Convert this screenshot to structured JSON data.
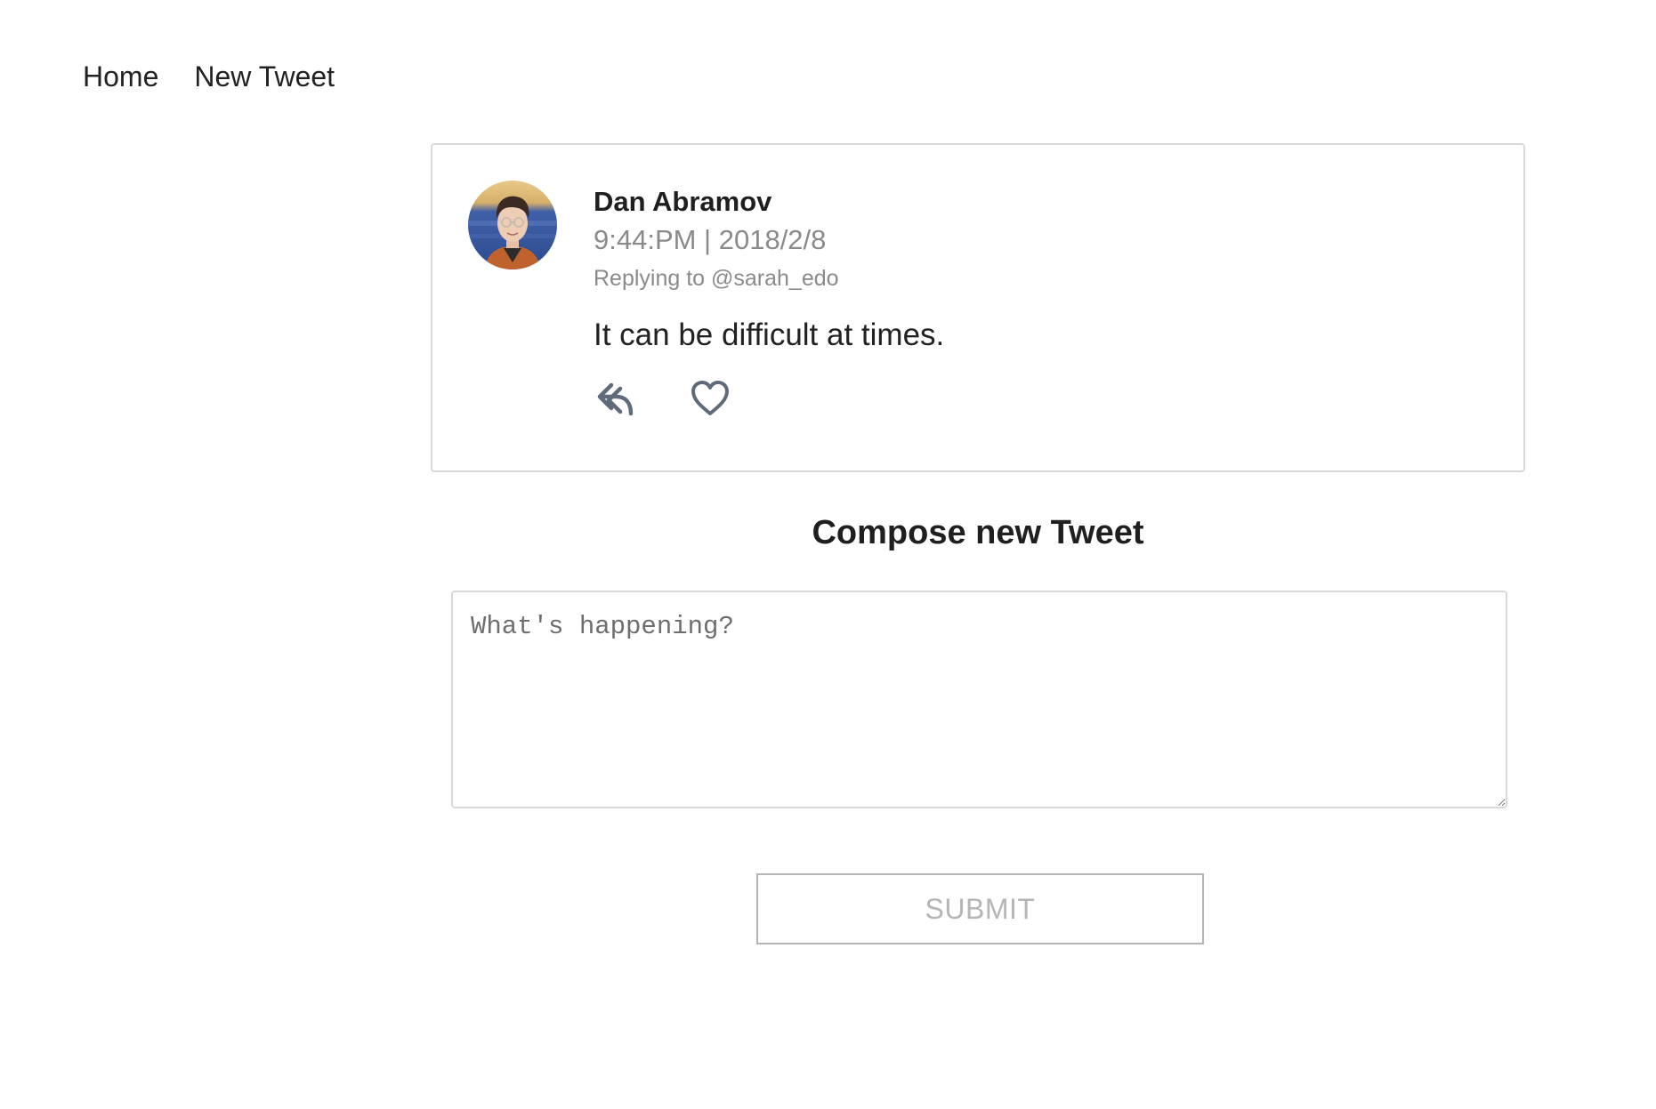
{
  "nav": {
    "items": [
      {
        "label": "Home"
      },
      {
        "label": "New Tweet"
      }
    ]
  },
  "tweet": {
    "author_name": "Dan Abramov",
    "timestamp": "9:44:PM | 2018/2/8",
    "replying_to": "Replying to @sarah_edo",
    "text": "It can be difficult at times.",
    "actions": {
      "reply_icon": "reply-icon",
      "like_icon": "heart-icon"
    },
    "icon_color": "#5f6b7a"
  },
  "compose": {
    "title": "Compose new Tweet",
    "placeholder": "What's happening?",
    "value": "",
    "submit_label": "SUBMIT"
  },
  "colors": {
    "border": "#d9d9d9",
    "muted_text": "#8a8a8a",
    "disabled_button": "#b5b5b5"
  }
}
